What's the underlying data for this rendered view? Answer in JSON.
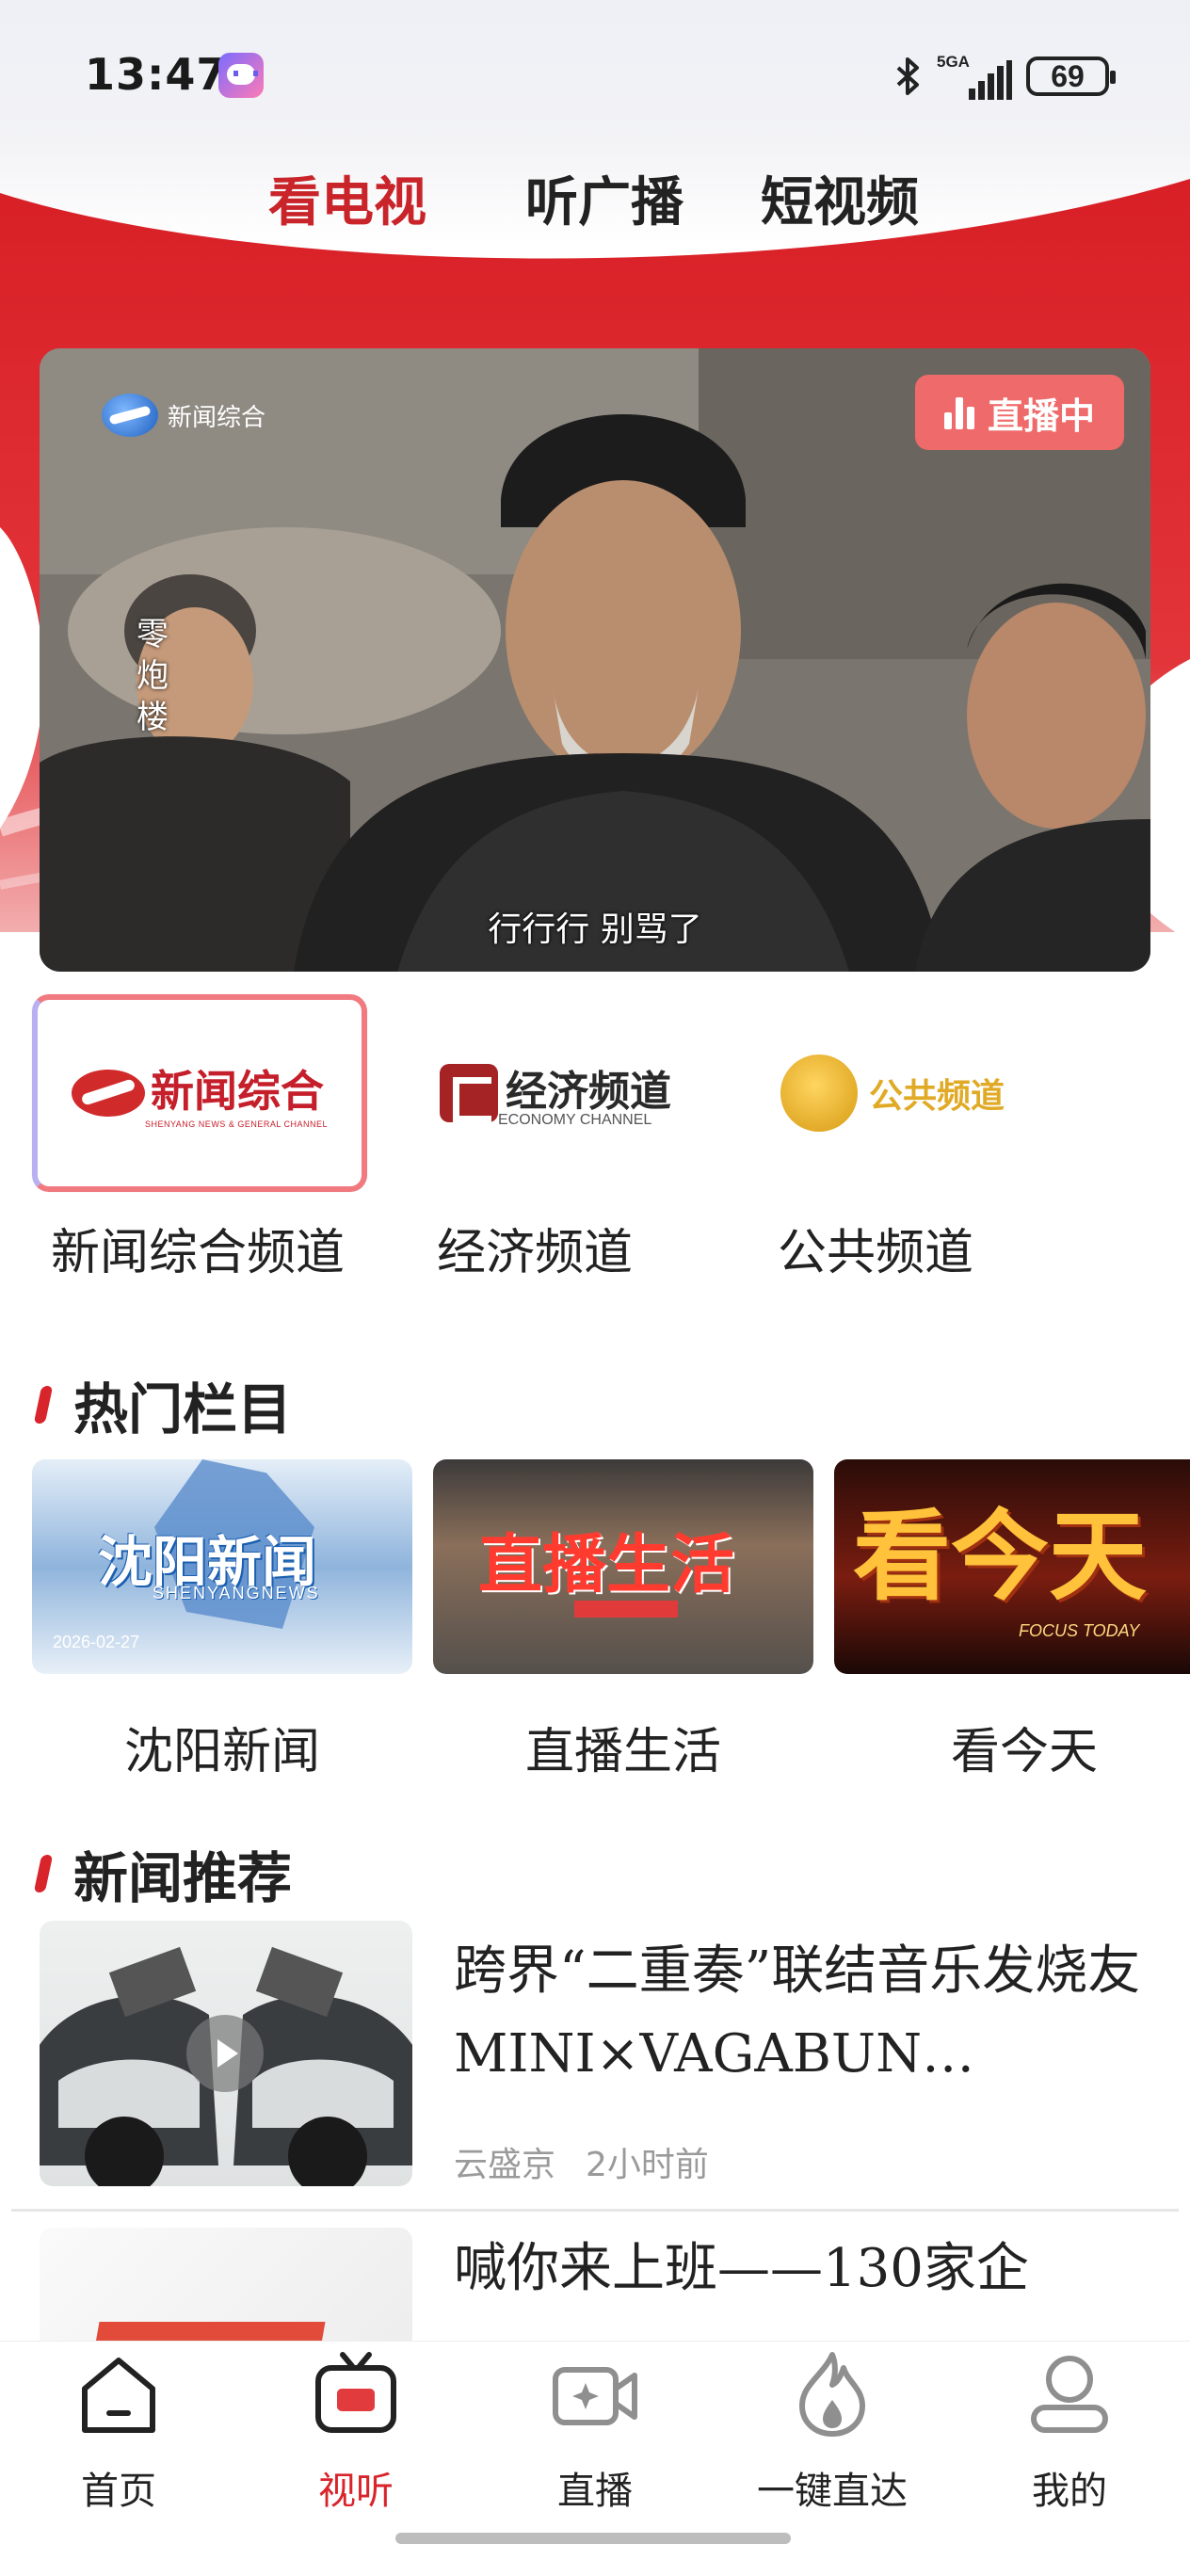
{
  "status_bar": {
    "time": "13:47",
    "network": "5GA",
    "battery": "69",
    "icons": [
      "app-icon",
      "bluetooth-icon",
      "signal-icon",
      "battery-icon"
    ]
  },
  "top_tabs": [
    {
      "label": "看电视",
      "active": true
    },
    {
      "label": "听广播",
      "active": false
    },
    {
      "label": "短视频",
      "active": false
    }
  ],
  "player": {
    "channel_logo": "新闻综合",
    "live_badge": "直播中",
    "program_title": "零炮楼",
    "subtitle": "行行行 别骂了"
  },
  "channels": [
    {
      "name": "新闻综合频道",
      "logo_text": "新闻综合",
      "logo_sub": "SHENYANG NEWS & GENERAL CHANNEL",
      "selected": true
    },
    {
      "name": "经济频道",
      "logo_text": "经济频道",
      "logo_sub": "ECONOMY CHANNEL",
      "selected": false
    },
    {
      "name": "公共频道",
      "logo_text": "公共频道",
      "selected": false
    }
  ],
  "hot_section": {
    "title": "热门栏目",
    "items": [
      {
        "name": "沈阳新闻",
        "thumb_title": "沈阳新闻",
        "thumb_sub": "SHENYANGNEWS",
        "thumb_date": "2026-02-27"
      },
      {
        "name": "直播生活",
        "thumb_title": "直播生活"
      },
      {
        "name": "看今天",
        "thumb_title": "看今天",
        "thumb_sub": "FOCUS TODAY"
      }
    ]
  },
  "news_section": {
    "title": "新闻推荐",
    "items": [
      {
        "title": "跨界“二重奏”联结音乐发烧友 MINI×VAGABUN…",
        "source": "云盛京",
        "time": "2小时前",
        "has_video": true
      },
      {
        "title": "喊你来上班——130家企",
        "source": "",
        "time": "",
        "has_video": false
      }
    ]
  },
  "bottom_nav": [
    {
      "label": "首页",
      "icon": "home-icon",
      "active": false
    },
    {
      "label": "视听",
      "icon": "tv-icon",
      "active": true
    },
    {
      "label": "直播",
      "icon": "live-camera-icon",
      "active": false
    },
    {
      "label": "一键直达",
      "icon": "flame-icon",
      "active": false
    },
    {
      "label": "我的",
      "icon": "profile-icon",
      "active": false
    }
  ],
  "colors": {
    "accent_red": "#d8252c",
    "live_badge": "#ef6a6a",
    "muted_text": "#9a9a9a"
  }
}
